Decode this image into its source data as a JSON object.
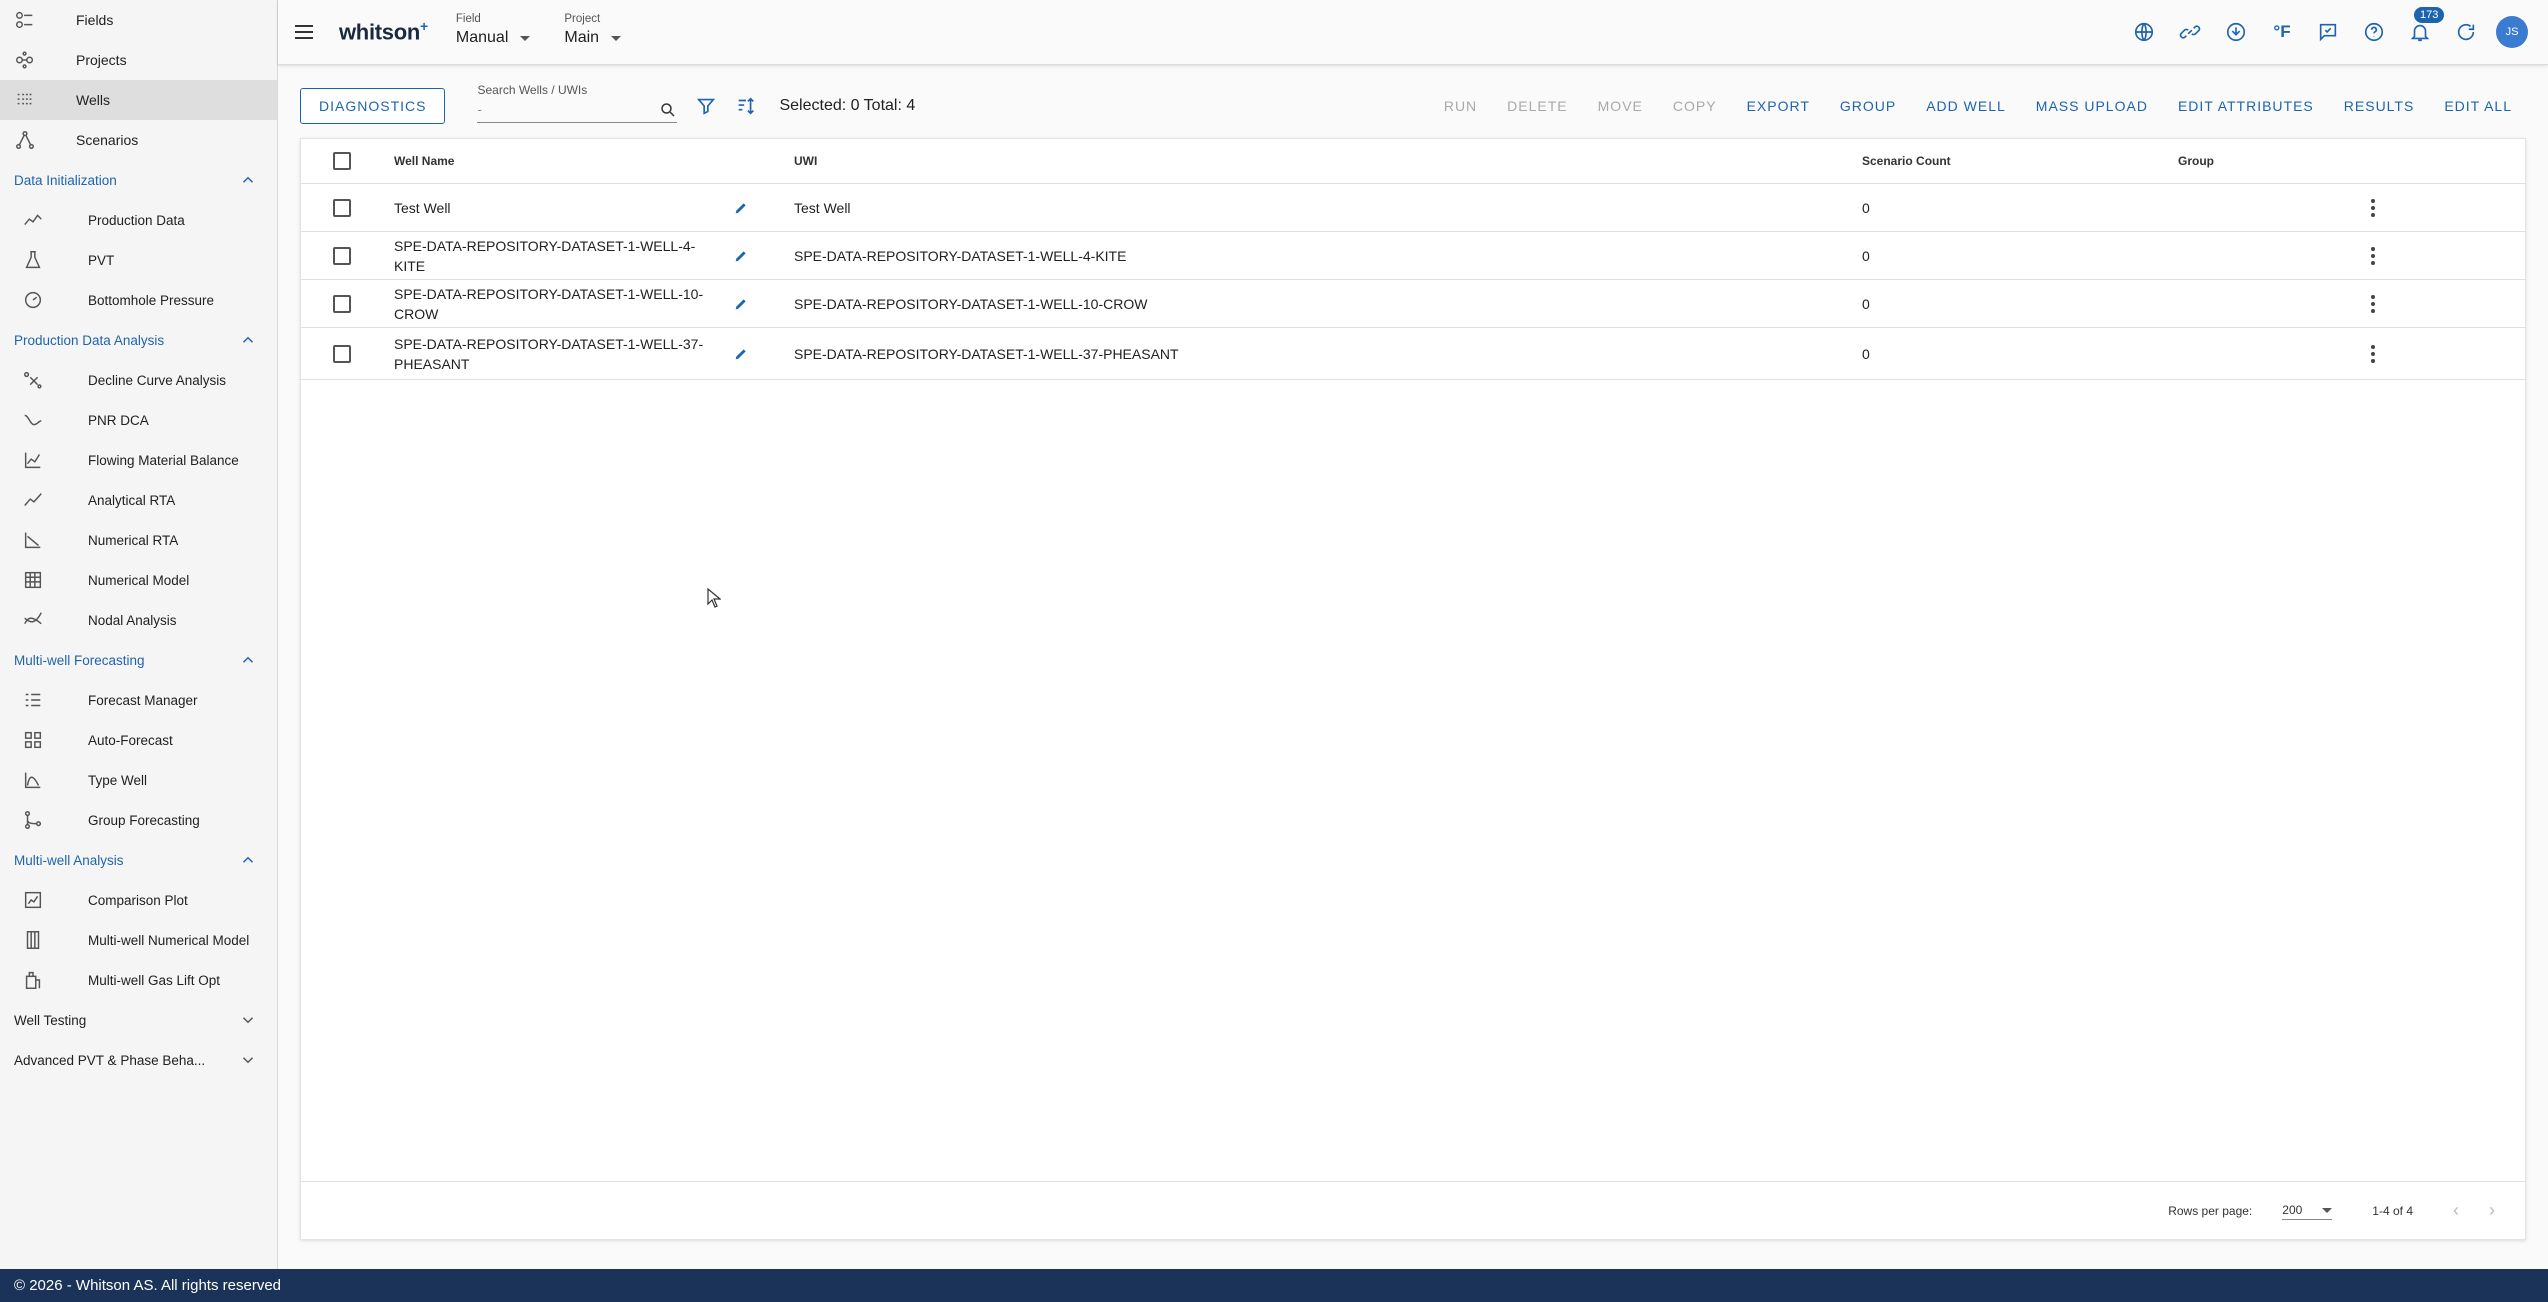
{
  "sidebar": {
    "top_items": [
      {
        "label": "Fields",
        "icon": "fields-icon"
      },
      {
        "label": "Projects",
        "icon": "projects-icon"
      },
      {
        "label": "Wells",
        "icon": "wells-icon",
        "active": true
      },
      {
        "label": "Scenarios",
        "icon": "scenarios-icon"
      }
    ],
    "sections": [
      {
        "title": "Data Initialization",
        "open": true,
        "items": [
          "Production Data",
          "PVT",
          "Bottomhole Pressure"
        ]
      },
      {
        "title": "Production Data Analysis",
        "open": true,
        "items": [
          "Decline Curve Analysis",
          "PNR DCA",
          "Flowing Material Balance",
          "Analytical RTA",
          "Numerical RTA",
          "Numerical Model",
          "Nodal Analysis"
        ]
      },
      {
        "title": "Multi-well Forecasting",
        "open": true,
        "items": [
          "Forecast Manager",
          "Auto-Forecast",
          "Type Well",
          "Group Forecasting"
        ]
      },
      {
        "title": "Multi-well Analysis",
        "open": true,
        "items": [
          "Comparison Plot",
          "Multi-well Numerical Model",
          "Multi-well Gas Lift Opt"
        ]
      },
      {
        "title": "Well Testing",
        "open": false,
        "items": []
      },
      {
        "title": "Advanced PVT & Phase Beha...",
        "open": false,
        "items": []
      }
    ]
  },
  "header": {
    "logo": "whitson",
    "logo_plus": "+",
    "field_label": "Field",
    "field_value": "Manual",
    "project_label": "Project",
    "project_value": "Main",
    "notification_count": "173",
    "units_label": "°F",
    "avatar_initials": "JS"
  },
  "toolbar": {
    "diagnostics_label": "DIAGNOSTICS",
    "search_label": "Search Wells / UWIs",
    "search_placeholder": "-",
    "selection_text": "Selected: 0 Total: 4",
    "actions": [
      {
        "label": "RUN",
        "enabled": false
      },
      {
        "label": "DELETE",
        "enabled": false
      },
      {
        "label": "MOVE",
        "enabled": false
      },
      {
        "label": "COPY",
        "enabled": false
      },
      {
        "label": "EXPORT",
        "enabled": true
      },
      {
        "label": "GROUP",
        "enabled": true
      },
      {
        "label": "ADD WELL",
        "enabled": true
      },
      {
        "label": "MASS UPLOAD",
        "enabled": true
      },
      {
        "label": "EDIT ATTRIBUTES",
        "enabled": true
      },
      {
        "label": "RESULTS",
        "enabled": true
      },
      {
        "label": "EDIT ALL",
        "enabled": true
      }
    ]
  },
  "table": {
    "columns": {
      "name": "Well Name",
      "uwi": "UWI",
      "count": "Scenario Count",
      "group": "Group"
    },
    "rows": [
      {
        "name": "Test Well",
        "uwi": "Test Well",
        "count": "0",
        "group": ""
      },
      {
        "name": "SPE-DATA-REPOSITORY-DATASET-1-WELL-4-KITE",
        "uwi": "SPE-DATA-REPOSITORY-DATASET-1-WELL-4-KITE",
        "count": "0",
        "group": ""
      },
      {
        "name": "SPE-DATA-REPOSITORY-DATASET-1-WELL-10-CROW",
        "uwi": "SPE-DATA-REPOSITORY-DATASET-1-WELL-10-CROW",
        "count": "0",
        "group": ""
      },
      {
        "name": "SPE-DATA-REPOSITORY-DATASET-1-WELL-37-PHEASANT",
        "uwi": "SPE-DATA-REPOSITORY-DATASET-1-WELL-37-PHEASANT",
        "count": "0",
        "group": ""
      }
    ],
    "footer": {
      "rows_per_page_label": "Rows per page:",
      "rows_per_page_value": "200",
      "range": "1-4 of 4"
    }
  },
  "footer": {
    "copyright": "© 2026 - Whitson AS. All rights reserved"
  },
  "colors": {
    "accent": "#1d64b0",
    "footer_bg": "#1b3358",
    "disabled": "#a9a9a9"
  }
}
